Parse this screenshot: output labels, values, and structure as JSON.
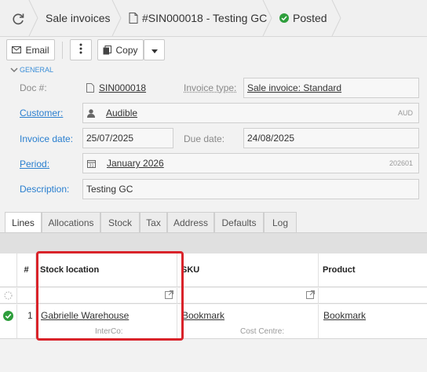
{
  "breadcrumbs": [
    {
      "label": "Sale invoices"
    },
    {
      "label": "#SIN000018 - Testing GC"
    },
    {
      "label": "Posted"
    }
  ],
  "toolbar": {
    "email_label": "Email",
    "copy_label": "Copy"
  },
  "form": {
    "section": "GENERAL",
    "doc_label": "Doc #:",
    "doc_value": "SIN000018",
    "invoice_type_label": "Invoice type:",
    "invoice_type_value": "Sale invoice: Standard",
    "customer_label": "Customer:",
    "customer_value": "Audible",
    "customer_currency": "AUD",
    "invoice_date_label": "Invoice date:",
    "invoice_date_value": "25/07/2025",
    "due_date_label": "Due date:",
    "due_date_value": "24/08/2025",
    "period_label": "Period:",
    "period_value": "January 2026",
    "period_code": "202601",
    "description_label": "Description:",
    "description_value": "Testing GC"
  },
  "tabs": [
    "Lines",
    "Allocations",
    "Stock",
    "Tax",
    "Address",
    "Defaults",
    "Log"
  ],
  "grid": {
    "columns": {
      "num": "#",
      "stock_location": "Stock location",
      "sku": "SKU",
      "product": "Product"
    },
    "rows": [
      {
        "num": "1",
        "stock_location": "Gabrielle Warehouse",
        "sku": "Bookmark",
        "product": "Bookmark",
        "sub_intercol": "InterCo:",
        "sub_costcentre": "Cost Centre:"
      }
    ]
  },
  "colors": {
    "accent": "#2a7fcf",
    "status_ok": "#2e9e3c",
    "highlight": "#d9232a"
  }
}
